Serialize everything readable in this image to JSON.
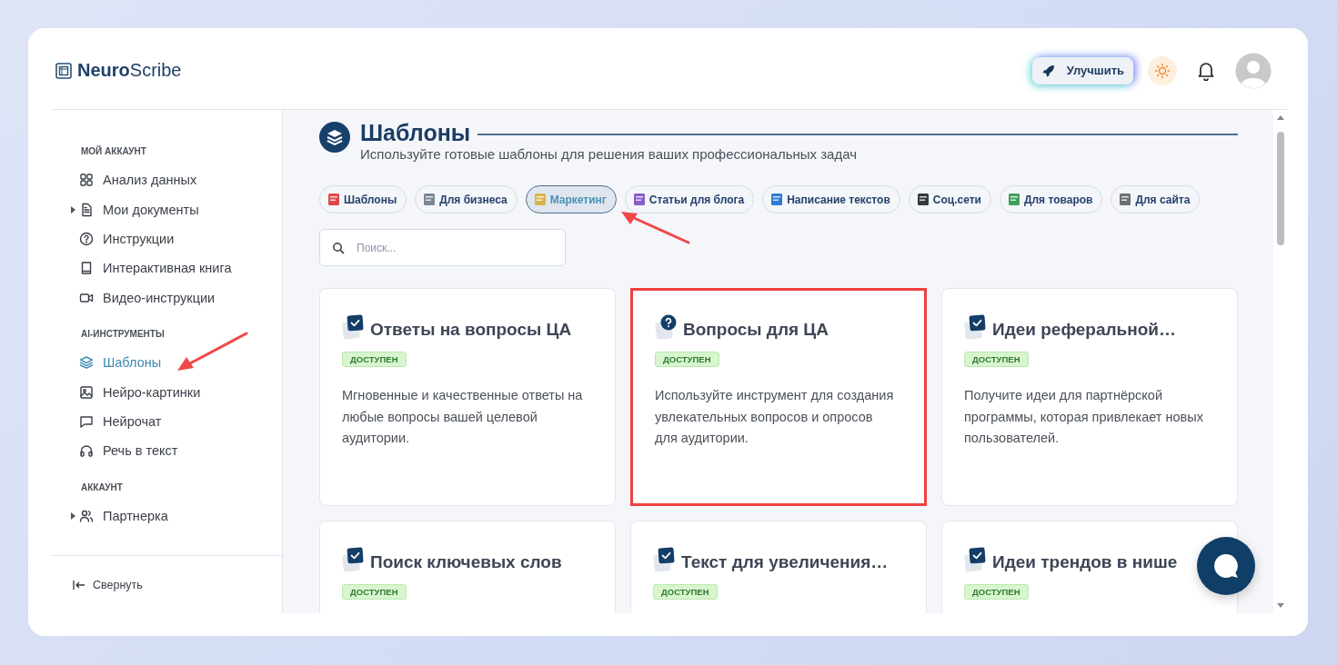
{
  "brand": {
    "bold": "Neuro",
    "light": "Scribe"
  },
  "header": {
    "upgrade_label": "Улучшить"
  },
  "sidebar": {
    "sections": [
      {
        "title": "МОЙ АККАУНТ",
        "items": [
          {
            "label": "Анализ данных",
            "expandable": false,
            "selected": false
          },
          {
            "label": "Мои документы",
            "expandable": true,
            "selected": false
          },
          {
            "label": "Инструкции",
            "expandable": false,
            "selected": false
          },
          {
            "label": "Интерактивная книга",
            "expandable": false,
            "selected": false
          },
          {
            "label": "Видео-инструкции",
            "expandable": false,
            "selected": false
          }
        ]
      },
      {
        "title": "AI-ИНСТРУМЕНТЫ",
        "items": [
          {
            "label": "Шаблоны",
            "expandable": false,
            "selected": true
          },
          {
            "label": "Нейро-картинки",
            "expandable": false,
            "selected": false
          },
          {
            "label": "Нейрочат",
            "expandable": false,
            "selected": false
          },
          {
            "label": "Речь в текст",
            "expandable": false,
            "selected": false
          }
        ]
      },
      {
        "title": "АККАУНТ",
        "items": [
          {
            "label": "Партнерка",
            "expandable": true,
            "selected": false
          }
        ]
      }
    ],
    "collapse_label": "Свернуть"
  },
  "page": {
    "title": "Шаблоны",
    "subtitle": "Используйте готовые шаблоны для решения ваших профессиональных задач"
  },
  "categories": [
    {
      "label": "Шаблоны",
      "selected": false
    },
    {
      "label": "Для бизнеса",
      "selected": false
    },
    {
      "label": "Маркетинг",
      "selected": true
    },
    {
      "label": "Статьи для блога",
      "selected": false
    },
    {
      "label": "Написание текстов",
      "selected": false
    },
    {
      "label": "Соц.сети",
      "selected": false
    },
    {
      "label": "Для товаров",
      "selected": false
    },
    {
      "label": "Для сайта",
      "selected": false
    }
  ],
  "search": {
    "placeholder": "Поиск..."
  },
  "cards": [
    {
      "kind": "check",
      "title": "Ответы на вопросы ЦА",
      "badge": "ДОСТУПЕН",
      "description": "Мгновенные и качественные ответы на любые вопросы вашей целевой аудитории.",
      "highlighted": false
    },
    {
      "kind": "question",
      "title": "Вопросы для ЦА",
      "badge": "ДОСТУПЕН",
      "description": "Используйте инструмент для создания увлекательных вопросов и опросов для аудитории.",
      "highlighted": true
    },
    {
      "kind": "check",
      "title": "Идеи реферальной…",
      "badge": "ДОСТУПЕН",
      "description": "Получите идеи для партнёрской программы, которая привлекает новых пользователей.",
      "highlighted": false
    },
    {
      "kind": "check",
      "title": "Поиск ключевых слов",
      "badge": "ДОСТУПЕН",
      "highlighted": false
    },
    {
      "kind": "check",
      "title": "Текст для увеличения…",
      "badge": "ДОСТУПЕН",
      "highlighted": false
    },
    {
      "kind": "check",
      "title": "Идеи трендов в нише",
      "badge": "ДОСТУПЕН",
      "highlighted": false
    }
  ]
}
